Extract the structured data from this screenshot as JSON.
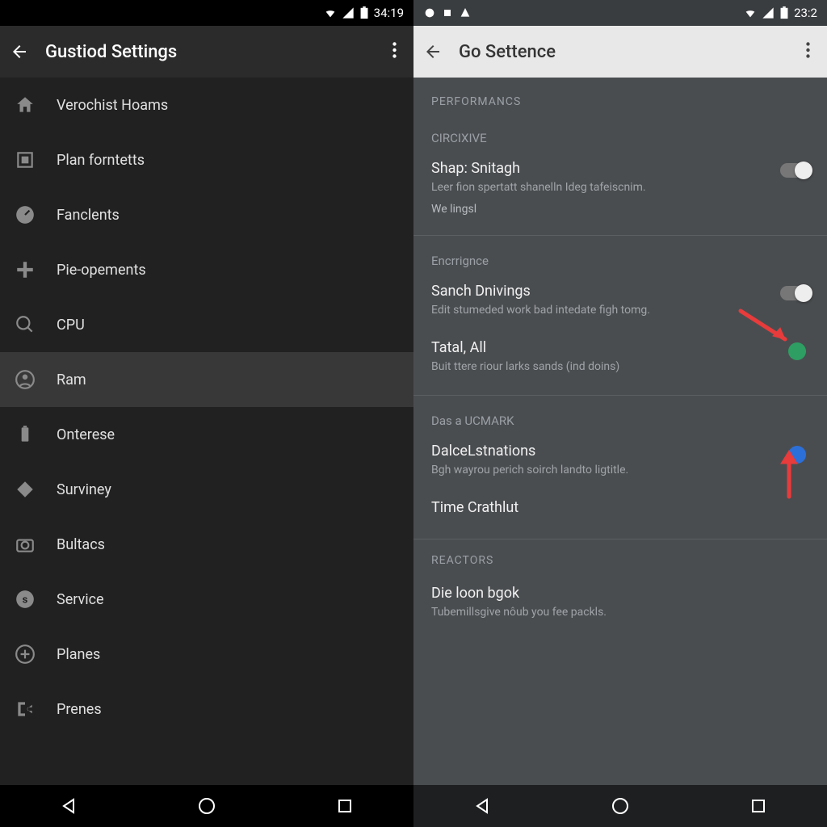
{
  "left": {
    "status_time": "34:19",
    "title": "Gustiod Settings",
    "items": [
      {
        "label": "Verochist Hoams",
        "icon": "home"
      },
      {
        "label": "Plan forntetts",
        "icon": "square"
      },
      {
        "label": "Fanclents",
        "icon": "gauge"
      },
      {
        "label": "Pie-opements",
        "icon": "plus"
      },
      {
        "label": "CPU",
        "icon": "search"
      },
      {
        "label": "Ram",
        "icon": "person"
      },
      {
        "label": "Onterese",
        "icon": "battery"
      },
      {
        "label": "Surviney",
        "icon": "diamond"
      },
      {
        "label": "Bultacs",
        "icon": "camera"
      },
      {
        "label": "Service",
        "icon": "circle-s"
      },
      {
        "label": "Planes",
        "icon": "plus-circle"
      },
      {
        "label": "Prenes",
        "icon": "exit"
      }
    ]
  },
  "right": {
    "status_time": "23:2",
    "title": "Go Settence",
    "section1": "PERFORMANCS",
    "sub1": "CIRCIXIVE",
    "pref1_title": "Shap: Snitagh",
    "pref1_sub": "Leer fion spertatt shanelln Ideg tafeiscnim.",
    "pref1_extra": "We lingsl",
    "sub2": "Encrrignce",
    "pref2_title": "Sanch Dnivings",
    "pref2_sub": "Edit stumeded work bad intedate figh tomg.",
    "pref3_title": "Tatal, All",
    "pref3_sub": "Buit ttere riour larks sands (ind doins)",
    "sub3": "Das a UCMARK",
    "pref4_title": "DalceLstnations",
    "pref4_sub": "Bgh wayrou perich soirch landto ligtitle.",
    "pref5_title": "Time Crathlut",
    "section2": "REACTORS",
    "pref6_title": "Die loon bgok",
    "pref6_sub": "Tubemillsgive nôub you fee packls."
  }
}
